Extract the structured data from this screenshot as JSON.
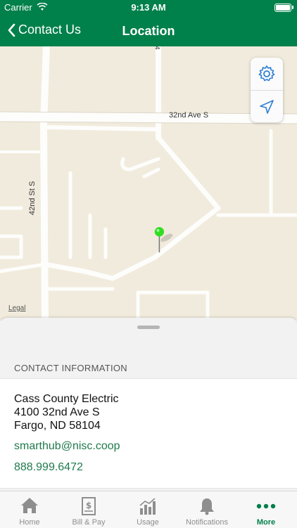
{
  "status_bar": {
    "carrier": "Carrier",
    "time": "9:13 AM"
  },
  "nav": {
    "back_label": "Contact Us",
    "title": "Location"
  },
  "map": {
    "road_labels": {
      "avenue": "32nd Ave S",
      "street": "42nd St S",
      "top_fragment": "4"
    },
    "legal": "Legal",
    "controls": [
      "settings-gear-icon",
      "location-arrow-icon"
    ],
    "pin_color": "#33dd22"
  },
  "contact": {
    "section_header": "CONTACT INFORMATION",
    "name": "Cass County Electric",
    "address_line1": "4100 32nd Ave S",
    "address_line2": "Fargo, ND 58104",
    "email": "smarthub@nisc.coop",
    "phone": "888.999.6472"
  },
  "tab_bar": {
    "tabs": [
      {
        "label": "Home",
        "icon": "home-icon"
      },
      {
        "label": "Bill & Pay",
        "icon": "bill-icon"
      },
      {
        "label": "Usage",
        "icon": "usage-chart-icon"
      },
      {
        "label": "Notifications",
        "icon": "bell-icon"
      },
      {
        "label": "More",
        "icon": "more-dots-icon"
      }
    ],
    "active": "More"
  },
  "colors": {
    "brand": "#00804a",
    "link": "#1f7a4d",
    "map_bg": "#f1ebdd",
    "control_blue": "#2f7fd3"
  }
}
